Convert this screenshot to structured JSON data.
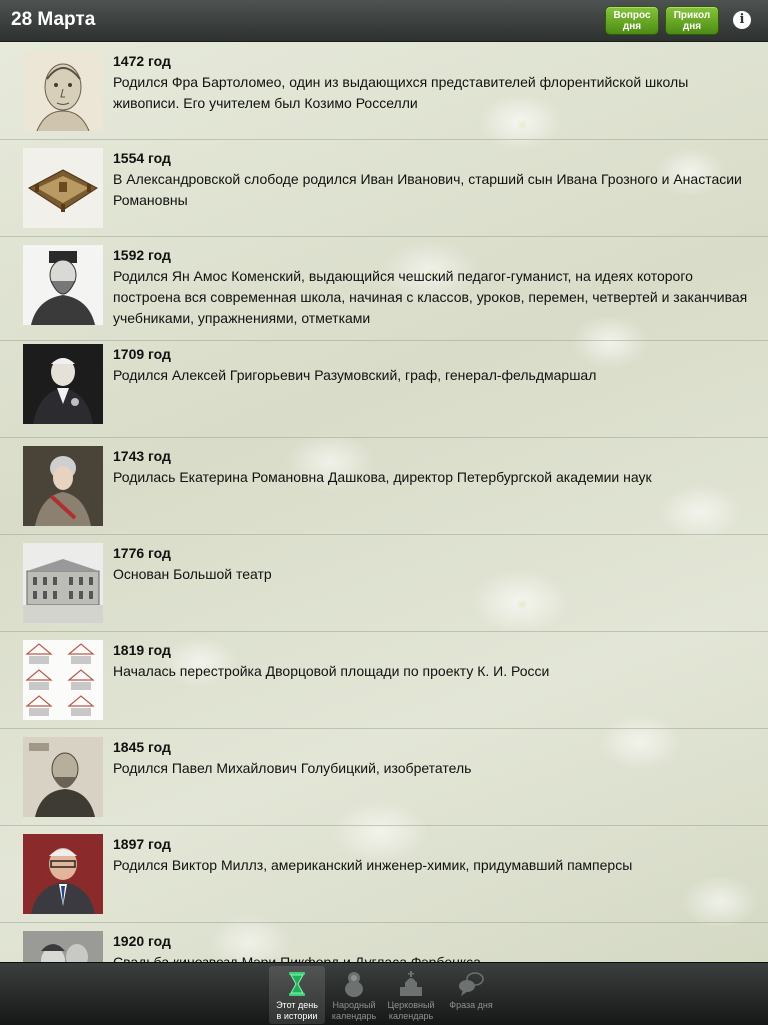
{
  "header": {
    "title": "28 Марта",
    "quiz_button": "Вопрос\nдня",
    "joke_button": "Прикол\nдня",
    "info_icon": "info-icon"
  },
  "events": [
    {
      "year": "1472 год",
      "text": "Родился Фра Бартоломео, один из выдающихся представителей флорентийской школы живописи. Его учителем был Козимо Росселли",
      "thumb": "portrait-sketch"
    },
    {
      "year": "1554 год",
      "text": "В Александровской слободе родился Иван Иванович, старший сын Ивана Грозного и Анастасии Романовны",
      "thumb": "fortress-model"
    },
    {
      "year": "1592 год",
      "text": "Родился Ян Амос Коменский, выдающийся чешский педагог-гуманист, на идеях которого построена вся современная школа, начиная с классов, уроков, перемен, четвертей и заканчивая учебниками, упражнениями, отметками",
      "thumb": "engraving-portrait"
    },
    {
      "year": "1709 год",
      "text": "Родился Алексей Григорьевич Разумовский, граф, генерал-фельдмаршал",
      "thumb": "noble-portrait"
    },
    {
      "year": "1743 год",
      "text": "Родилась Екатерина Романовна Дашкова, директор Петербургской академии наук",
      "thumb": "lady-portrait"
    },
    {
      "year": "1776 год",
      "text": "Основан Большой театр",
      "thumb": "theatre-building"
    },
    {
      "year": "1819 год",
      "text": "Началась перестройка Дворцовой площади по проекту К. И. Росси",
      "thumb": "architecture-plans"
    },
    {
      "year": "1845 год",
      "text": "Родился Павел Михайлович Голубицкий, изобретатель",
      "thumb": "old-photo-portrait"
    },
    {
      "year": "1897 год",
      "text": "Родился Виктор Миллз, американский инженер-химик, придумавший памперсы",
      "thumb": "photo-portrait"
    },
    {
      "year": "1920 год",
      "text": "Свадьба кинозвезд Мэри Пикфорд и Дугласа Фэрбенкса",
      "thumb": "couple-photo"
    }
  ],
  "tabs": [
    {
      "label": "Этот день\nв истории",
      "icon": "hourglass-icon",
      "active": true
    },
    {
      "label": "Народный\nкалендарь",
      "icon": "matryoshka-icon",
      "active": false
    },
    {
      "label": "Церковный\nкалендарь",
      "icon": "church-icon",
      "active": false
    },
    {
      "label": "Фраза дня",
      "icon": "speech-bubbles-icon",
      "active": false
    }
  ],
  "colors": {
    "accent_green": "#5fa21f",
    "topbar": "#3f4342",
    "tabbar": "#1e2120"
  }
}
